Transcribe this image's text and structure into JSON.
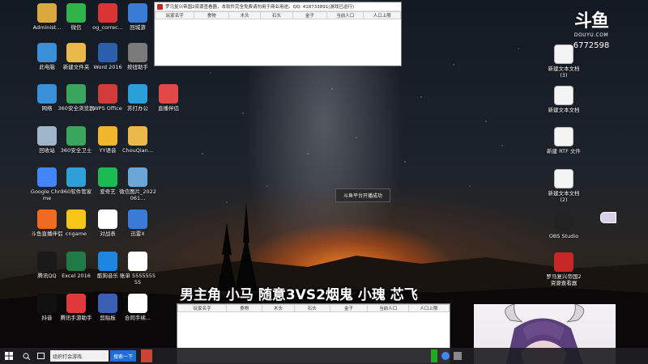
{
  "desktop": {
    "icons_left": [
      {
        "label": "Administ...",
        "icon": "user-folder-icon",
        "color": "#d9a93d"
      },
      {
        "label": "微信",
        "icon": "wechat-icon",
        "color": "#2fb34a"
      },
      {
        "label": "og_correc...",
        "icon": "red-app-icon",
        "color": "#d93535"
      },
      {
        "label": "回城游",
        "icon": "game-icon",
        "color": "#3a7bd5"
      },
      {
        "label": "此电脑",
        "icon": "computer-icon",
        "color": "#3a8fd9"
      },
      {
        "label": "新建文件夹",
        "icon": "folder-icon",
        "color": "#e9b94c"
      },
      {
        "label": "Word 2016",
        "icon": "word-icon",
        "color": "#2b5fab"
      },
      {
        "label": "按扭助手",
        "icon": "helper-icon",
        "color": "#7a7a7a"
      },
      {
        "label": "网络",
        "icon": "network-icon",
        "color": "#3a8fd9"
      },
      {
        "label": "360安全浏览器",
        "icon": "360-browser-icon",
        "color": "#3aa55d"
      },
      {
        "label": "WPS Office",
        "icon": "wps-icon",
        "color": "#d33b3b"
      },
      {
        "label": "苏打办公",
        "icon": "sudabangong-icon",
        "color": "#2a9fd8"
      },
      {
        "label": "直播伴侣",
        "icon": "live-companion-icon",
        "color": "#e24a4a"
      },
      {
        "label": "回收站",
        "icon": "recycle-bin-icon",
        "color": "#9fb6c9"
      },
      {
        "label": "360安全卫士",
        "icon": "360-guard-icon",
        "color": "#3aa55d"
      },
      {
        "label": "YY语音",
        "icon": "yy-icon",
        "color": "#f0b72c"
      },
      {
        "label": "ChouQian...",
        "icon": "folder-icon",
        "color": "#e9b94c"
      },
      {
        "label": "Google Chrome",
        "icon": "chrome-icon",
        "color": "#4285f4"
      },
      {
        "label": "360软件管家",
        "icon": "360-software-icon",
        "color": "#2f9fd8"
      },
      {
        "label": "爱奇艺",
        "icon": "iqiyi-icon",
        "color": "#1db953"
      },
      {
        "label": "微信图片_2022061...",
        "icon": "image-file-icon",
        "color": "#6aa6d8"
      },
      {
        "label": "斗鱼直播伴侣",
        "icon": "douyu-live-icon",
        "color": "#f06b22"
      },
      {
        "label": "cngame",
        "icon": "cngame-icon",
        "color": "#f5c518"
      },
      {
        "label": "对战表",
        "icon": "text-file-icon",
        "color": "#ffffff"
      },
      {
        "label": "迅雷X",
        "icon": "xunlei-icon",
        "color": "#3a7bd5"
      },
      {
        "label": "腾讯QQ",
        "icon": "qq-icon",
        "color": "#1a1a1a"
      },
      {
        "label": "Excel 2016",
        "icon": "excel-icon",
        "color": "#1f7a45"
      },
      {
        "label": "酷狗音乐",
        "icon": "kugou-icon",
        "color": "#1f86e0"
      },
      {
        "label": "账单 555555555",
        "icon": "sheet-file-icon",
        "color": "#ffffff"
      },
      {
        "label": "抖音",
        "icon": "douyin-icon",
        "color": "#111111"
      },
      {
        "label": "腾讯手游助手",
        "icon": "tencent-mobile-game-icon",
        "color": "#e23a3a"
      },
      {
        "label": "剪贴板",
        "icon": "clipboard-icon",
        "color": "#3a5fb0"
      },
      {
        "label": "合同手续...",
        "icon": "doc-file-icon",
        "color": "#ffffff"
      }
    ],
    "icons_right": [
      {
        "label": "新建文本文档 (3)",
        "icon": "text-file-icon"
      },
      {
        "label": "新建文本文档",
        "icon": "text-file-icon"
      },
      {
        "label": "新建 RTF 文件",
        "icon": "rtf-file-icon"
      },
      {
        "label": "新建文本文档 (2)",
        "icon": "text-file-icon"
      },
      {
        "label": "OBS Studio",
        "icon": "obs-icon"
      },
      {
        "label": "罗马复兴帝国2资源查看器",
        "icon": "roman-app-icon"
      }
    ]
  },
  "top_window": {
    "title": "罗马复兴帝国2资源查看器，本软件完全免费请勿用于商业用途。QQ: 418733891(游戏已运行)",
    "columns": [
      "玩家名字",
      "食物",
      "木头",
      "石头",
      "金子",
      "当前人口",
      "人口上限"
    ]
  },
  "bottom_window": {
    "columns": [
      "玩家名字",
      "食物",
      "木头",
      "石头",
      "金子",
      "当前人口",
      "人口上限"
    ]
  },
  "toast": {
    "text": "斗鱼平台开播成功"
  },
  "subtitle": {
    "text": "男主角  小马  随意3VS2烟鬼  小瑰  芯飞"
  },
  "logo": {
    "mark": "斗鱼",
    "sub": "DOUYU.COM",
    "room": "6772598"
  },
  "taskbar": {
    "search_placeholder": "组织打会游戏",
    "search_button": "搜索一下"
  },
  "colors": {
    "accent": "#1e6fd9",
    "brand": "#f06b22"
  }
}
